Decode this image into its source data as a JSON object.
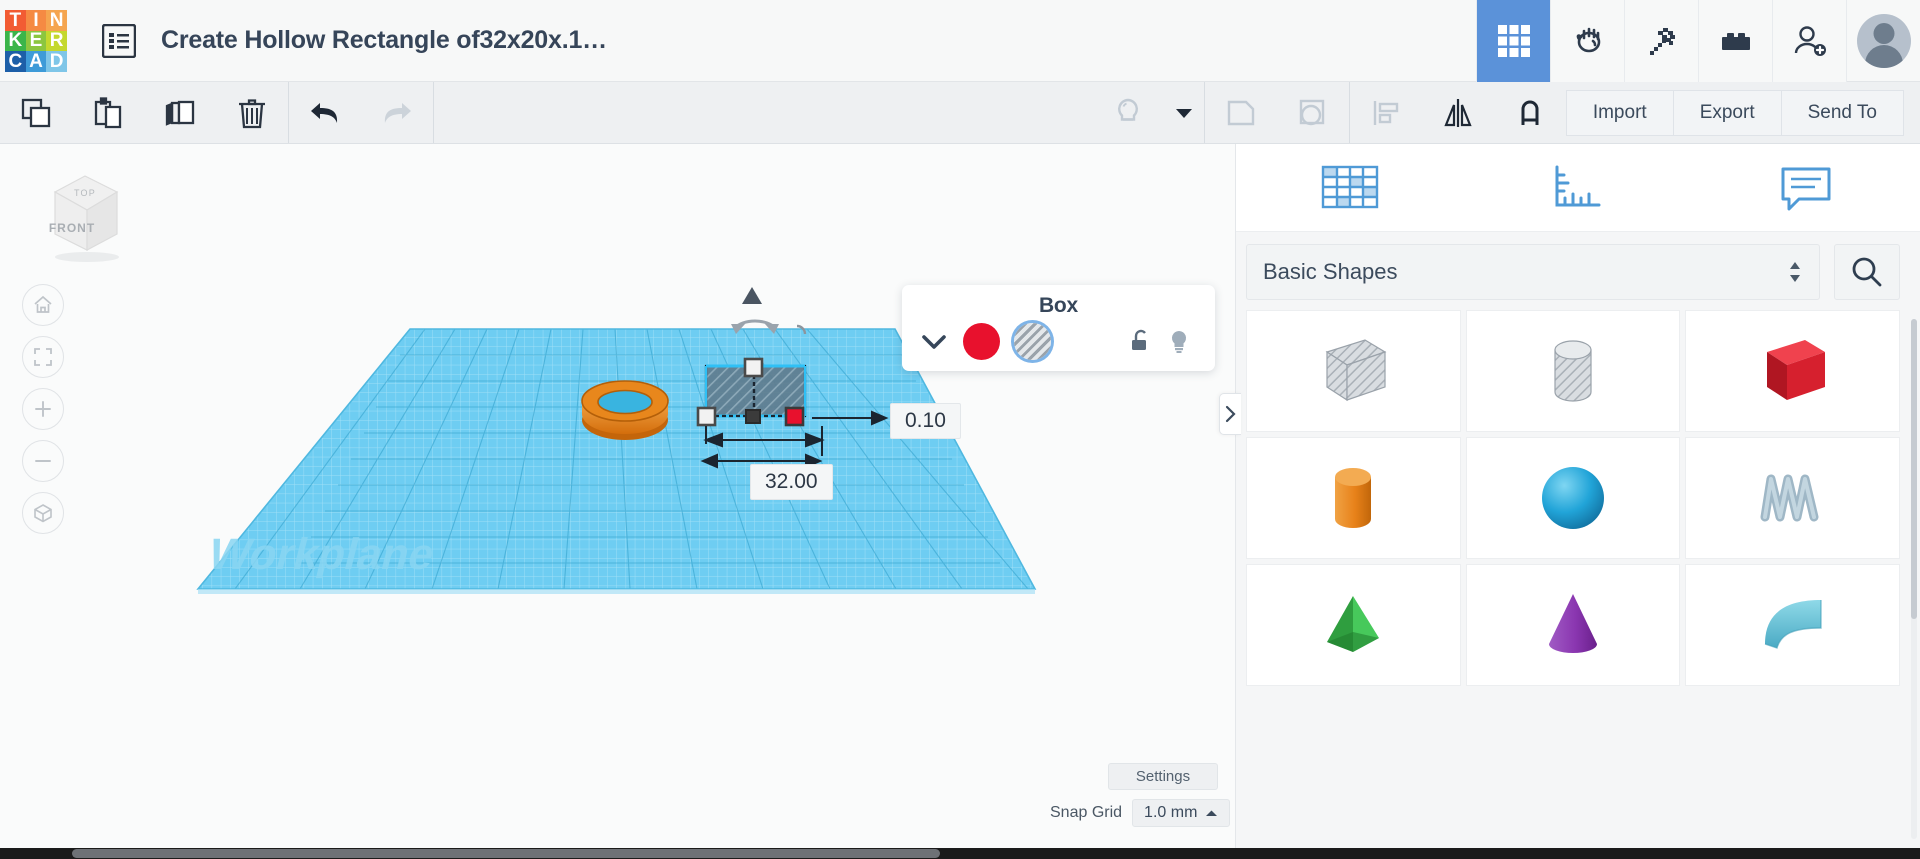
{
  "app": {
    "logo_letters": [
      {
        "ch": "T",
        "color": "#f25c33"
      },
      {
        "ch": "I",
        "color": "#f58a43"
      },
      {
        "ch": "N",
        "color": "#f5a54f"
      },
      {
        "ch": "K",
        "color": "#3bb54a"
      },
      {
        "ch": "E",
        "color": "#8cc63f"
      },
      {
        "ch": "R",
        "color": "#c4d82e"
      },
      {
        "ch": "C",
        "color": "#1d5fa8"
      },
      {
        "ch": "A",
        "color": "#3e9bd8"
      },
      {
        "ch": "D",
        "color": "#7fc6e8"
      }
    ],
    "hamburger_icon": "list-menu-icon",
    "document_title": "Create Hollow Rectangle of32x20x.1…"
  },
  "top_icons": [
    {
      "name": "grid-view-icon",
      "active": true
    },
    {
      "name": "blocks-hand-icon",
      "active": false
    },
    {
      "name": "pickaxe-minecraft-icon",
      "active": false
    },
    {
      "name": "lego-brick-icon",
      "active": false
    },
    {
      "name": "add-user-icon",
      "active": false
    }
  ],
  "toolbar": {
    "left_buttons": [
      {
        "name": "copy-button",
        "icon": "copy-icon"
      },
      {
        "name": "paste-button",
        "icon": "clipboard-icon"
      },
      {
        "name": "duplicate-button",
        "icon": "duplicate-icon"
      },
      {
        "name": "delete-button",
        "icon": "trash-icon"
      }
    ],
    "history_buttons": [
      {
        "name": "undo-button",
        "icon": "undo-arrow-icon"
      },
      {
        "name": "redo-button",
        "icon": "redo-arrow-icon"
      }
    ],
    "right_icon_buttons": [
      {
        "name": "light-toggle-button",
        "icon": "lightbulb-icon"
      },
      {
        "name": "light-dropdown-button",
        "icon": "caret-down-icon"
      },
      {
        "name": "group-button",
        "icon": "group-shapes-icon"
      },
      {
        "name": "ungroup-button",
        "icon": "ungroup-shapes-icon"
      },
      {
        "name": "align-button",
        "icon": "align-icon"
      },
      {
        "name": "mirror-button",
        "icon": "mirror-flip-icon"
      },
      {
        "name": "snap-button",
        "icon": "magnet-icon"
      }
    ],
    "import_label": "Import",
    "export_label": "Export",
    "send_to_label": "Send To"
  },
  "viewport": {
    "viewcube": {
      "top_face": "TOP",
      "front_face": "FRONT"
    },
    "nav_buttons": [
      {
        "name": "home-view-button",
        "icon": "home-icon"
      },
      {
        "name": "fit-to-view-button",
        "icon": "fit-frame-icon"
      },
      {
        "name": "zoom-in-button",
        "icon": "plus-icon"
      },
      {
        "name": "zoom-out-button",
        "icon": "minus-icon"
      },
      {
        "name": "perspective-toggle-button",
        "icon": "cube-perspective-icon"
      }
    ],
    "workplane_label": "Workplane",
    "dimension_labels": [
      {
        "name": "height-dimension-label",
        "value": "0.10"
      },
      {
        "name": "width-dimension-label",
        "value": "32.00"
      }
    ],
    "settings_label": "Settings",
    "snap_grid_label": "Snap Grid",
    "snap_grid_value": "1.0 mm",
    "collapse_panel_icon": "chevron-right-icon"
  },
  "box_panel": {
    "title": "Box",
    "collapse_icon": "chevron-down-icon",
    "solid_swatch_color": "#e8112d",
    "hole_swatch_name": "hole-swatch",
    "lock_icon": "unlocked-padlock-icon",
    "light_icon": "lightbulb-icon"
  },
  "right_panel": {
    "tabs": [
      {
        "name": "tab-shapes-grid",
        "icon": "grid-shapes-icon"
      },
      {
        "name": "tab-ruler",
        "icon": "ruler-icon"
      },
      {
        "name": "tab-notes",
        "icon": "note-bubble-icon"
      }
    ],
    "category_value": "Basic Shapes",
    "search_icon": "search-icon",
    "shapes": [
      {
        "name": "shape-box-hole",
        "label": "Box (hole)"
      },
      {
        "name": "shape-cylinder-hole",
        "label": "Cylinder (hole)"
      },
      {
        "name": "shape-box-red",
        "label": "Box"
      },
      {
        "name": "shape-cylinder-orange",
        "label": "Cylinder"
      },
      {
        "name": "shape-sphere-blue",
        "label": "Sphere"
      },
      {
        "name": "shape-scribble",
        "label": "Scribble"
      },
      {
        "name": "shape-pyramid-green",
        "label": "Pyramid"
      },
      {
        "name": "shape-cone-purple",
        "label": "Cone"
      },
      {
        "name": "shape-roof-teal",
        "label": "Roof"
      }
    ]
  },
  "colors": {
    "accent_blue": "#5b92d9",
    "dark_slate": "#36465a",
    "workplane_blue": "#5bc8f0",
    "hole_red": "#e8112d",
    "torus_orange": "#e07b18"
  }
}
